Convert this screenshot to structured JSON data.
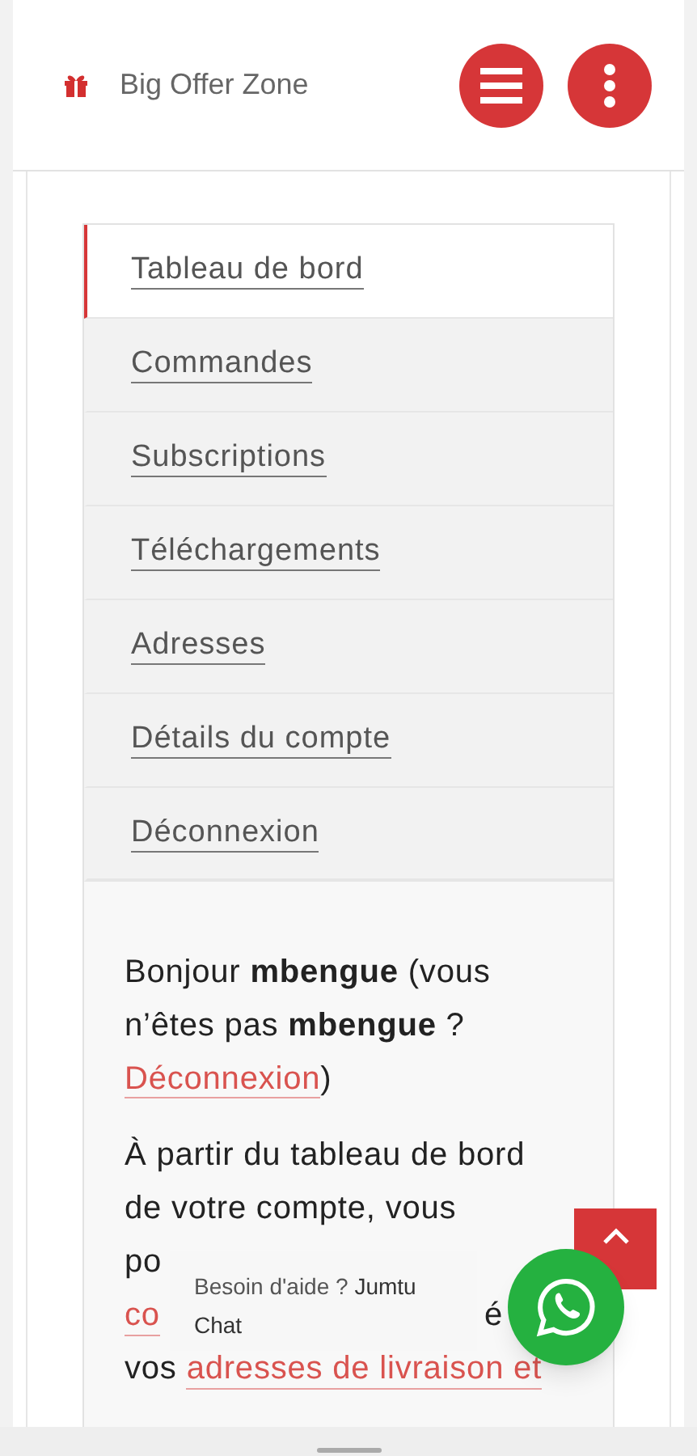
{
  "header": {
    "brand": "Big Offer Zone"
  },
  "account_menu": [
    {
      "label": "Tableau de bord",
      "selected": true
    },
    {
      "label": "Commandes",
      "selected": false
    },
    {
      "label": "Subscriptions",
      "selected": false
    },
    {
      "label": "Téléchargements",
      "selected": false
    },
    {
      "label": "Adresses",
      "selected": false
    },
    {
      "label": "Détails du compte",
      "selected": false
    },
    {
      "label": "Déconnexion",
      "selected": false
    }
  ],
  "greeting": {
    "text": "Bonjour **mbengue** (vous n’êtes pas **mbengue** ?",
    "link": "Déconnexion",
    "closing": ")"
  },
  "intro_lines": [
    [
      {
        "text": "À partir du tableau de bord",
        "kind": "plain"
      }
    ],
    [
      {
        "text": "de votre compte, vous",
        "kind": "plain"
      }
    ],
    [
      {
        "text": "po",
        "kind": "plain"
      }
    ],
    [
      {
        "text": "co",
        "kind": "link"
      },
      {
        "text": "é",
        "kind": "trailing"
      }
    ],
    [
      {
        "text": "vos",
        "kind": "plain"
      },
      {
        "text": "adresses de livraison et",
        "kind": "link"
      }
    ]
  ],
  "chat_bubble": {
    "text": "Besoin d'aide ? **Jumtu Chat**"
  }
}
